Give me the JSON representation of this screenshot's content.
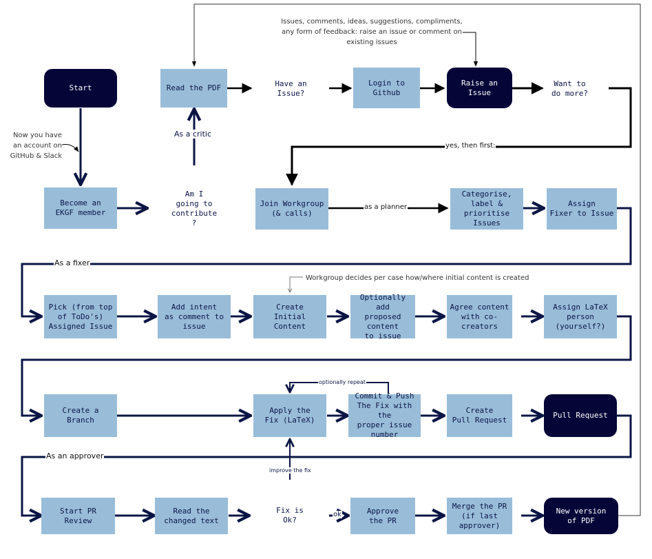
{
  "colors": {
    "process_fill": "#99bdd9",
    "terminal_fill": "#050538",
    "decision_fill": "#efbcbc",
    "edge_navy": "#0b1545",
    "edge_black": "#000000",
    "edge_gray": "#555555"
  },
  "nodes": {
    "start": "Start",
    "read_pdf": "Read the PDF",
    "have_issue": "Have an\nIssue?",
    "login_github": "Login to\nGithub",
    "raise_issue": "Raise an Issue",
    "want_more": "Want to\ndo more?",
    "become_member": "Become an\nEKGF member",
    "contribute": "Am I\ngoing to\ncontribute\n?",
    "join_workgroup": "Join Workgroup\n(& calls)",
    "categorise": "Categorise,\nlabel &\nprioritise\nIssues",
    "assign_fixer": "Assign\nFixer to Issue",
    "pick_issue": "Pick (from top\nof ToDo's)\nAssigned Issue",
    "add_intent": "Add intent\nas comment to\nissue",
    "create_content": "Create\nInitial Content",
    "optionally_add": "Optionally add\nproposed content\nto issue",
    "agree_content": "Agree content\nwith co-creators",
    "assign_latex": "Assign LaTeX\nperson\n(yourself?)",
    "create_branch": "Create a Branch",
    "apply_fix": "Apply the\nFix (LaTeX)",
    "commit_push": "Commit & Push\nThe Fix with the\nproper issue\nnumber",
    "create_pr": "Create\nPull Request",
    "pull_request": "Pull Request",
    "start_review": "Start PR\nReview",
    "read_changed": "Read the\nchanged text",
    "fix_ok": "Fix is\nOk?",
    "approve_pr": "Approve\nthe PR",
    "merge_pr": "Merge the PR\n(if last\napprover)",
    "new_version": "New version\nof PDF"
  },
  "edge_labels": {
    "as_critic": "As a critic",
    "yes_then_first": "yes, then first:",
    "as_planner": "as a planner",
    "as_fixer": "As a fixer",
    "as_approver": "As an approver",
    "optionally_repeat": "optionally repeat",
    "improve_fix": "improve the fix",
    "ok": "ok"
  },
  "notes": {
    "account": "Now you have\nan account on\nGitHub & Slack",
    "feedback": "Issues, comments, ideas, suggestions, compliments,\nany form of feedback: raise an issue or comment on\nexisting issues",
    "workgroup_decides": "Workgroup decides per case how/where initial content is created"
  }
}
